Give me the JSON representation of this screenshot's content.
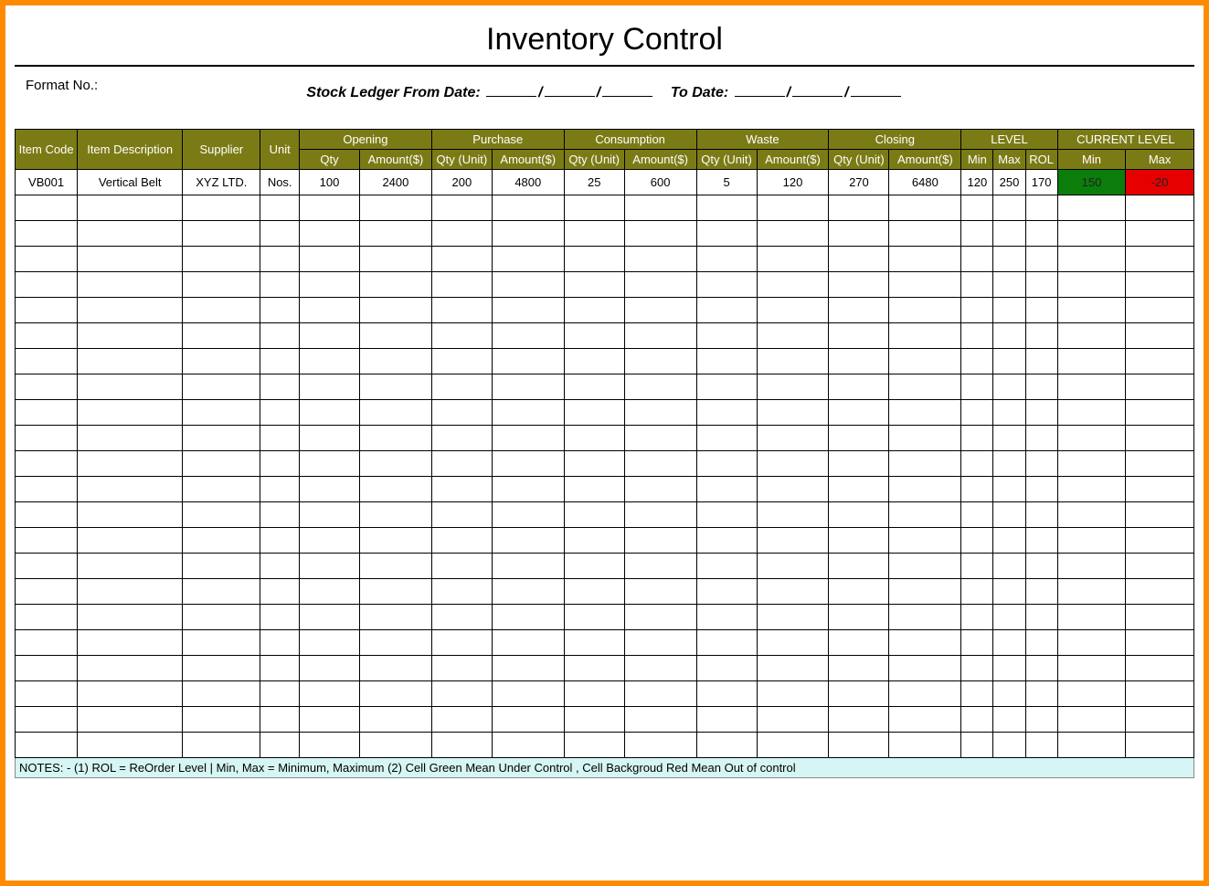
{
  "title": "Inventory Control",
  "format_no_label": "Format No.:",
  "ledger": {
    "prefix": "Stock Ledger From Date:",
    "to": "To Date:"
  },
  "headers": {
    "item_code": "Item Code",
    "item_desc": "Item Description",
    "supplier": "Supplier",
    "unit": "Unit",
    "groups": {
      "opening": "Opening",
      "purchase": "Purchase",
      "consumption": "Consumption",
      "waste": "Waste",
      "closing": "Closing",
      "level": "LEVEL",
      "current_level": "CURRENT LEVEL"
    },
    "sub": {
      "qty": "Qty",
      "qty_unit": "Qty (Unit)",
      "amount": "Amount($)",
      "min": "Min",
      "max": "Max",
      "rol": "ROL"
    }
  },
  "rows": [
    {
      "item_code": "VB001",
      "item_desc": "Vertical Belt",
      "supplier": "XYZ LTD.",
      "unit": "Nos.",
      "opening_qty": "100",
      "opening_amt": "2400",
      "purchase_qty": "200",
      "purchase_amt": "4800",
      "consumption_qty": "25",
      "consumption_amt": "600",
      "waste_qty": "5",
      "waste_amt": "120",
      "closing_qty": "270",
      "closing_amt": "6480",
      "level_min": "120",
      "level_max": "250",
      "level_rol": "170",
      "current_min": "150",
      "current_max": "-20",
      "current_min_flag": "ok",
      "current_max_flag": "bad"
    }
  ],
  "empty_rows": 22,
  "notes": "NOTES: - (1) ROL = ReOrder Level | Min, Max = Minimum, Maximum     (2) Cell Green Mean Under Control , Cell Backgroud Red Mean Out of control"
}
